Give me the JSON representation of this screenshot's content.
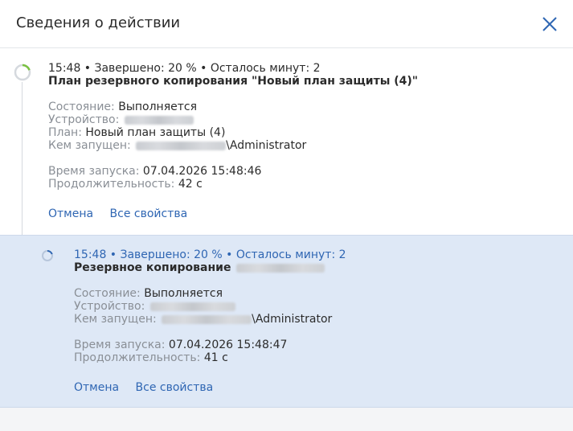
{
  "dialog": {
    "title": "Сведения о действии"
  },
  "main_activity": {
    "summary": "15:48 • Завершено: 20 % • Осталось минут: 2",
    "title": "План резервного копирования \"Новый план защиты (4)\"",
    "state_label": "Состояние:",
    "state_value": "Выполняется",
    "device_label": "Устройство:",
    "plan_label": "План:",
    "plan_value": "Новый план защиты (4)",
    "launched_by_label": "Кем запущен:",
    "launched_by_suffix": "\\Administrator",
    "start_label": "Время запуска:",
    "start_value": "07.04.2026 15:48:46",
    "duration_label": "Продолжительность:",
    "duration_value": "42 с",
    "cancel_label": "Отмена",
    "all_props_label": "Все свойства"
  },
  "child_activity": {
    "summary": "15:48 • Завершено: 20 % • Осталось минут: 2",
    "title": "Резервное копирование",
    "state_label": "Состояние:",
    "state_value": "Выполняется",
    "device_label": "Устройство:",
    "launched_by_label": "Кем запущен:",
    "launched_by_suffix": "\\Administrator",
    "start_label": "Время запуска:",
    "start_value": "07.04.2026 15:48:47",
    "duration_label": "Продолжительность:",
    "duration_value": "41 с",
    "cancel_label": "Отмена",
    "all_props_label": "Все свойства"
  },
  "colors": {
    "accent": "#2f66b3",
    "selected_bg": "#dee8f6",
    "progress_green": "#7ac142"
  },
  "icons": {
    "close": "close-icon",
    "main_progress": "progress-spinner-icon",
    "child_progress": "progress-spinner-icon"
  }
}
